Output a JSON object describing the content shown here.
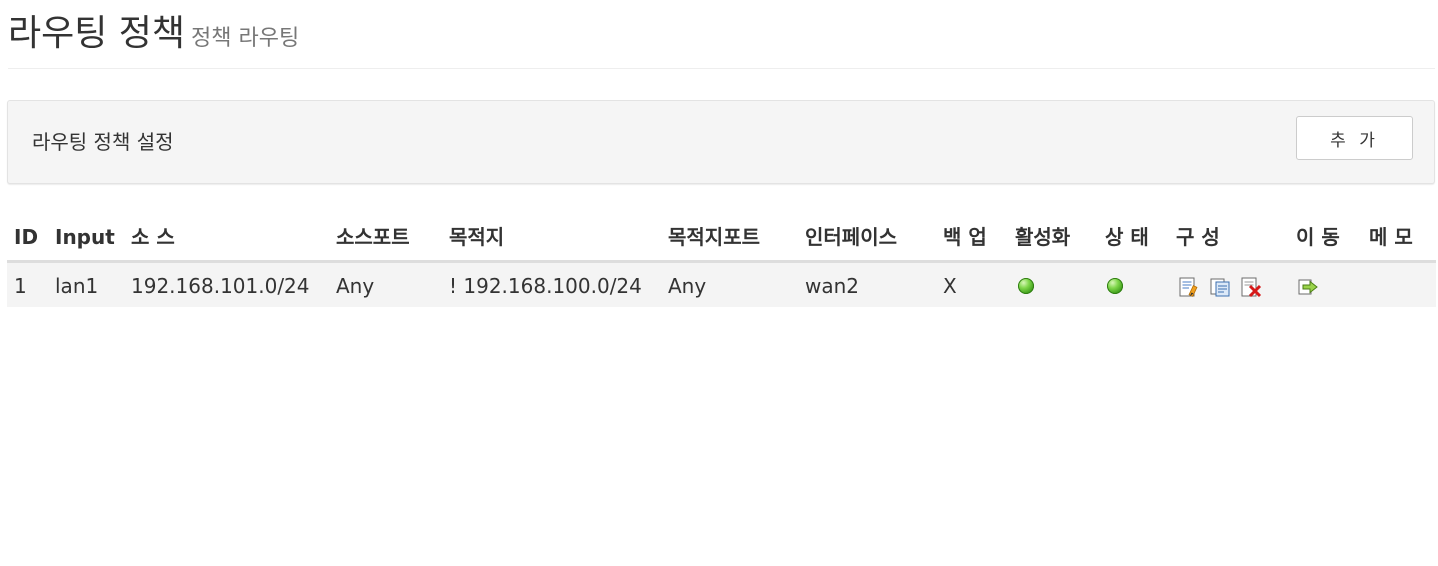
{
  "header": {
    "title": "라우팅 정책",
    "subtitle": "정책 라우팅"
  },
  "panel": {
    "title": "라우팅 정책 설정",
    "add_label": "추 가"
  },
  "table": {
    "columns": [
      "ID",
      "Input",
      "소 스",
      "소스포트",
      "목적지",
      "목적지포트",
      "인터페이스",
      "백 업",
      "활성화",
      "상 태",
      "구 성",
      "이 동",
      "메 모"
    ],
    "rows": [
      {
        "id": "1",
        "input": "lan1",
        "source": "192.168.101.0/24",
        "source_port": "Any",
        "destination": "! 192.168.100.0/24",
        "destination_port": "Any",
        "interface": "wan2",
        "backup": "X",
        "enabled": "on",
        "status": "on",
        "config_icons": [
          "edit-icon",
          "copy-icon",
          "delete-icon"
        ],
        "move_icon": "move-icon",
        "memo": ""
      }
    ]
  },
  "colors": {
    "led_green": "#5cc22c",
    "panel_bg": "#f5f5f5",
    "row_bg": "#f4f4f4",
    "header_border": "#dddddd"
  }
}
